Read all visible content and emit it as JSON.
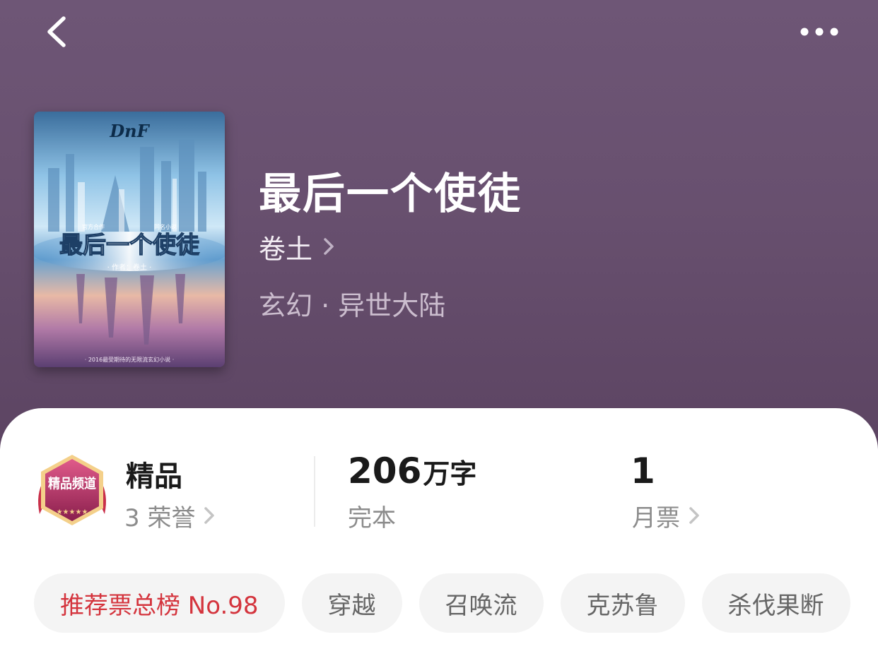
{
  "book": {
    "title": "最后一个使徒",
    "author": "卷土",
    "genre": "玄幻 · 异世大陆"
  },
  "cover": {
    "logo_text": "DnF",
    "title_text": "最后一个使徒",
    "author_text": "· 作者：卷土 ·",
    "top_text_left": "官方合作",
    "top_text_right": "同名小说",
    "bottom_text": "· 2016最受期待的无限流玄幻小说 ·"
  },
  "stats": {
    "badge_text": "精品频道",
    "quality_label": "精品",
    "honors": "3 荣誉",
    "word_count_number": "206",
    "word_count_unit": "万字",
    "status": "完本",
    "monthly_tickets": "1",
    "monthly_label": "月票"
  },
  "tags": [
    "推荐票总榜 No.98",
    "穿越",
    "召唤流",
    "克苏鲁",
    "杀伐果断"
  ],
  "colors": {
    "hero_bg": "#68506f",
    "hot_tag": "#d4343d",
    "tag_bg": "#f4f4f4"
  },
  "icons": {
    "back": "chevron-left-icon",
    "more": "more-dots-icon",
    "arrow": "chevron-right-icon"
  }
}
